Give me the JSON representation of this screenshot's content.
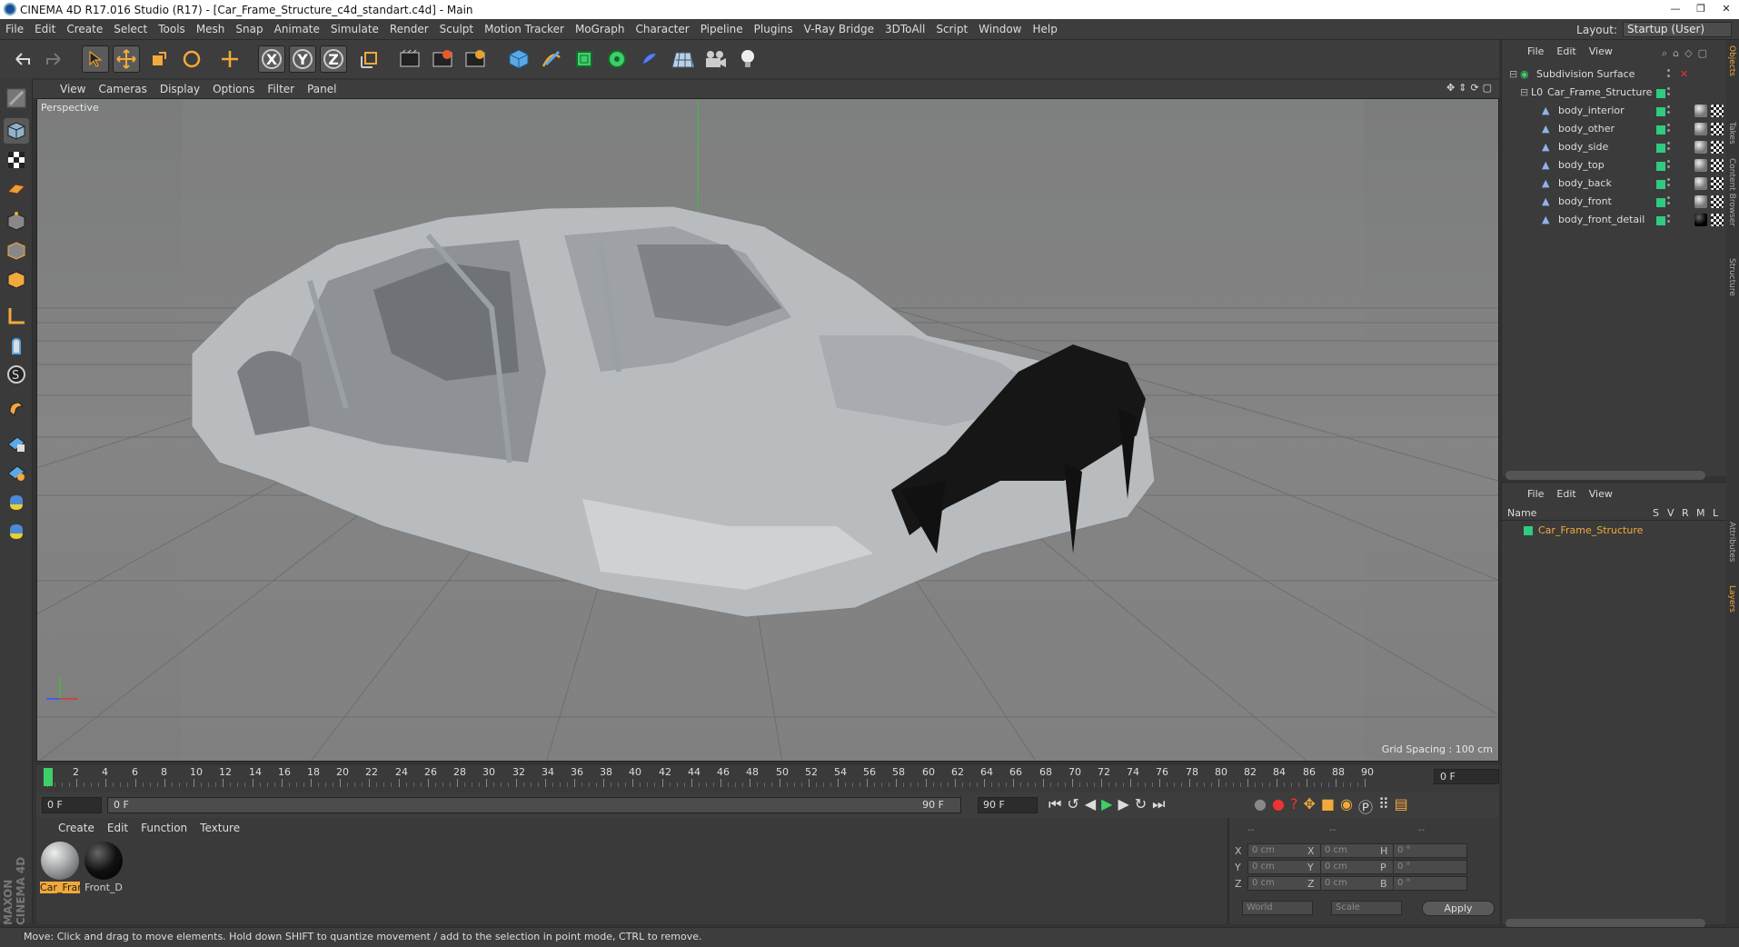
{
  "titlebar": {
    "title": "CINEMA 4D R17.016 Studio (R17) - [Car_Frame_Structure_c4d_standart.c4d] - Main",
    "min": "—",
    "max": "❐",
    "close": "✕"
  },
  "menu": [
    "File",
    "Edit",
    "Create",
    "Select",
    "Tools",
    "Mesh",
    "Snap",
    "Animate",
    "Simulate",
    "Render",
    "Sculpt",
    "Motion Tracker",
    "MoGraph",
    "Character",
    "Pipeline",
    "Plugins",
    "V-Ray Bridge",
    "3DToAll",
    "Script",
    "Window",
    "Help"
  ],
  "layout": {
    "label": "Layout:",
    "value": "Startup (User)"
  },
  "toolbar": {
    "x": "X",
    "y": "Y",
    "z": "Z"
  },
  "viewport": {
    "menu": [
      "View",
      "Cameras",
      "Display",
      "Options",
      "Filter",
      "Panel"
    ],
    "label": "Perspective",
    "grid": "Grid Spacing : 100 cm"
  },
  "timeline": {
    "ticks": [
      "0",
      "2",
      "4",
      "6",
      "8",
      "10",
      "12",
      "14",
      "16",
      "18",
      "20",
      "22",
      "24",
      "26",
      "28",
      "30",
      "32",
      "34",
      "36",
      "38",
      "40",
      "42",
      "44",
      "46",
      "48",
      "50",
      "52",
      "54",
      "56",
      "58",
      "60",
      "62",
      "64",
      "66",
      "68",
      "70",
      "72",
      "74",
      "76",
      "78",
      "80",
      "82",
      "84",
      "86",
      "88",
      "90"
    ],
    "frame": "0 F"
  },
  "transport": {
    "start": "0 F",
    "slider_start": "0 F",
    "slider_end": "90 F",
    "end": "90 F"
  },
  "materials": {
    "menu": [
      "Create",
      "Edit",
      "Function",
      "Texture"
    ],
    "items": [
      {
        "name": "Car_Frar"
      },
      {
        "name": "Front_D"
      }
    ]
  },
  "coords": {
    "headers": [
      "--",
      "--",
      "--"
    ],
    "rows": [
      {
        "l1": "X",
        "v1": "0 cm",
        "l2": "X",
        "v2": "0 cm",
        "l3": "H",
        "v3": "0 °"
      },
      {
        "l1": "Y",
        "v1": "0 cm",
        "l2": "Y",
        "v2": "0 cm",
        "l3": "P",
        "v3": "0 °"
      },
      {
        "l1": "Z",
        "v1": "0 cm",
        "l2": "Z",
        "v2": "0 cm",
        "l3": "B",
        "v3": "0 °"
      }
    ],
    "space": "World",
    "mode": "Scale",
    "apply": "Apply"
  },
  "objects": {
    "menu": [
      "File",
      "Edit",
      "View"
    ],
    "items": [
      {
        "name": "Subdivision Surface",
        "depth": 0
      },
      {
        "name": "Car_Frame_Structure",
        "depth": 1
      },
      {
        "name": "body_interior",
        "depth": 2
      },
      {
        "name": "body_other",
        "depth": 2
      },
      {
        "name": "body_side",
        "depth": 2
      },
      {
        "name": "body_top",
        "depth": 2
      },
      {
        "name": "body_back",
        "depth": 2
      },
      {
        "name": "body_front",
        "depth": 2
      },
      {
        "name": "body_front_detail",
        "depth": 2
      }
    ]
  },
  "layers": {
    "menu": [
      "File",
      "Edit",
      "View"
    ],
    "header": {
      "name": "Name",
      "cols": [
        "S",
        "V",
        "R",
        "M",
        "L"
      ]
    },
    "item": "Car_Frame_Structure"
  },
  "sidetabs": [
    "Objects",
    "Takes",
    "Content Browser",
    "Structure",
    "Attributes",
    "Layers"
  ],
  "brand": "MAXON CINEMA 4D",
  "status": "Move: Click and drag to move elements. Hold down SHIFT to quantize movement / add to the selection in point mode, CTRL to remove."
}
